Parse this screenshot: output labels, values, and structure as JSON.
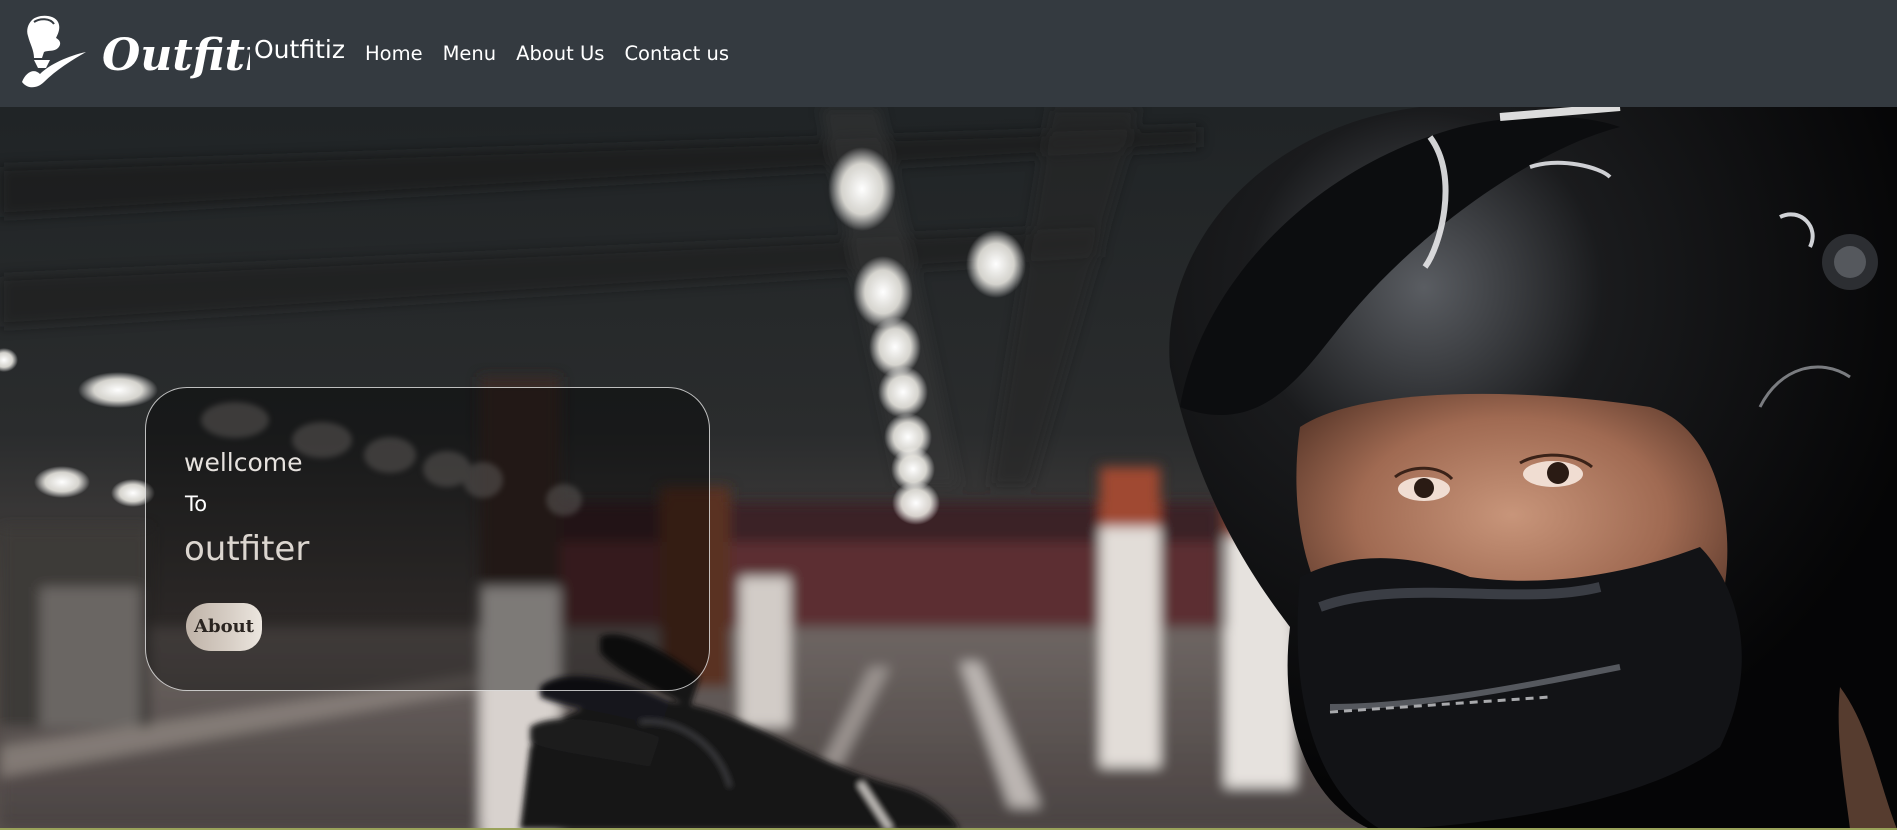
{
  "navbar": {
    "logo_text": "Outfitiz",
    "brand": "Outfitiz",
    "links": [
      {
        "label": "Home"
      },
      {
        "label": "Menu"
      },
      {
        "label": "About Us"
      },
      {
        "label": "Contact us"
      }
    ],
    "background": "#343a40"
  },
  "hero": {
    "card": {
      "line1": "wellcome",
      "line2": "To",
      "line3": "outfiter",
      "button_label": "About"
    }
  },
  "icons": [
    "logo-mascot-icon"
  ]
}
